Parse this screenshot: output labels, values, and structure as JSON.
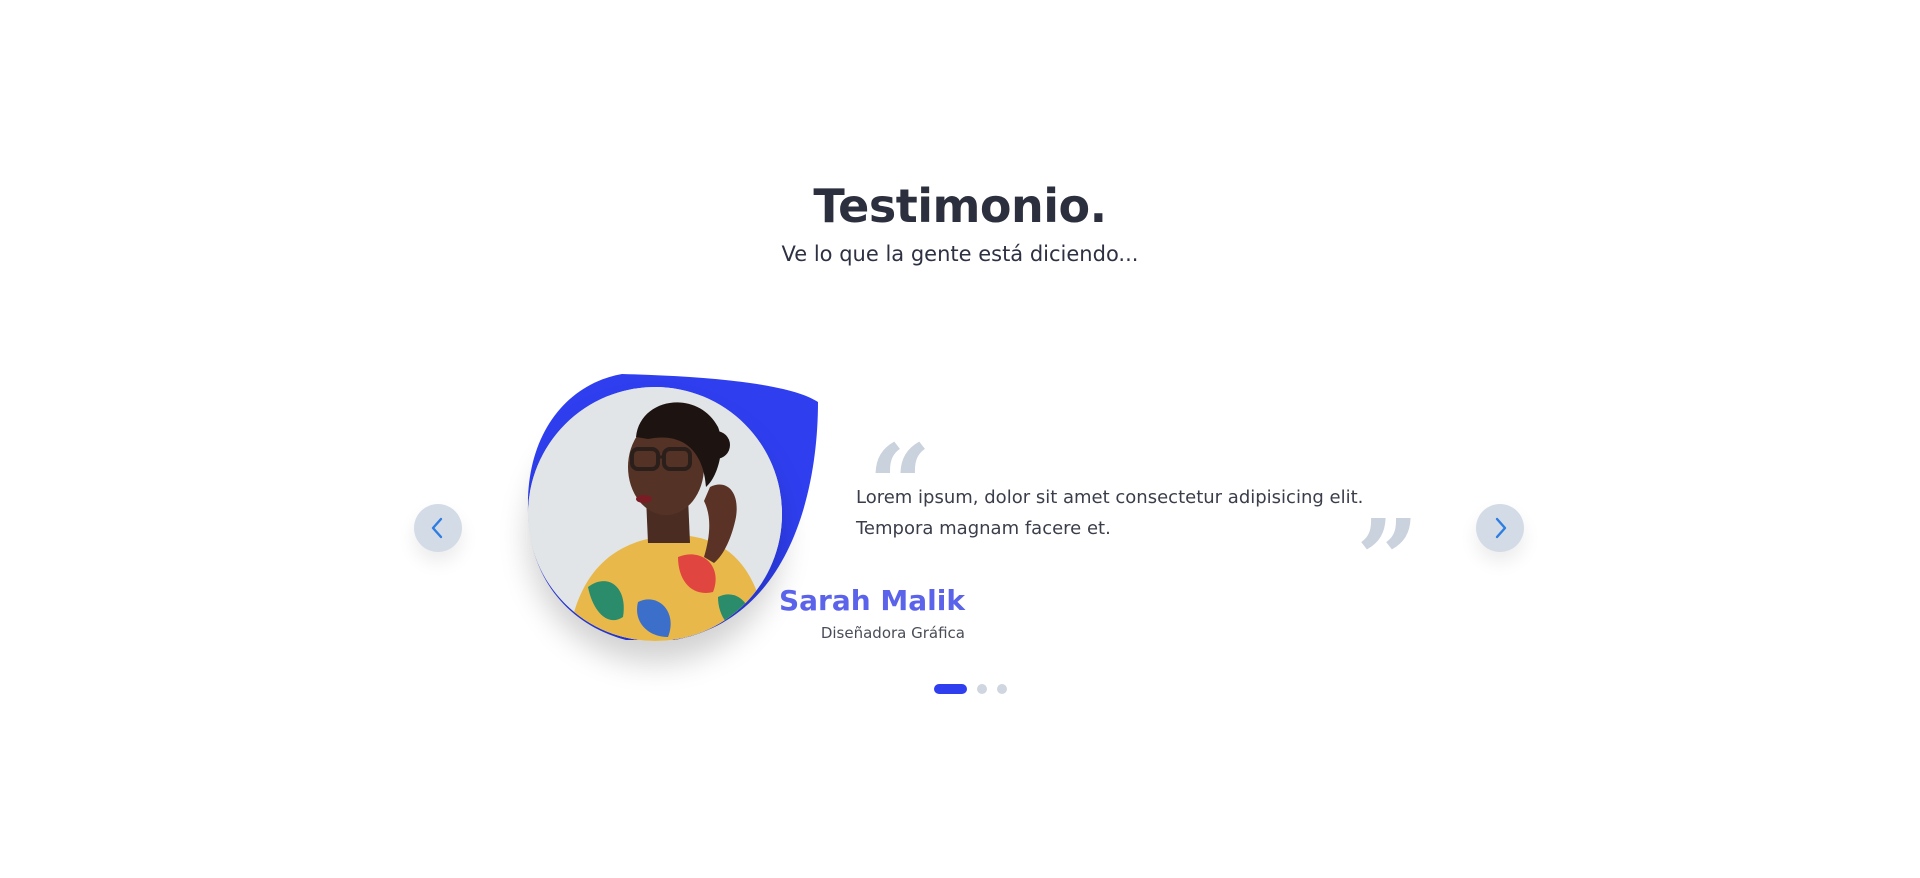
{
  "section": {
    "title": "Testimonio.",
    "subtitle": "Ve lo que la gente está diciendo..."
  },
  "testimonial": {
    "quote_line_1": "Lorem ipsum, dolor sit amet consectetur adipisicing elit.",
    "quote_line_2": "Tempora magnam facere et.",
    "name": "Sarah Malik",
    "role": "Diseñadora Gráfica",
    "open_quote_glyph": "“",
    "close_quote_glyph": "”"
  },
  "carousel": {
    "active_index": 0,
    "slide_count": 3,
    "prev_icon": "chevron-left-icon",
    "next_icon": "chevron-right-icon"
  },
  "colors": {
    "accent": "#2f3ff0",
    "name": "#5b63ea",
    "title": "#2b2f3e",
    "nav_bg": "#d3dbe6",
    "quote_marks": "#c9d2dd"
  }
}
